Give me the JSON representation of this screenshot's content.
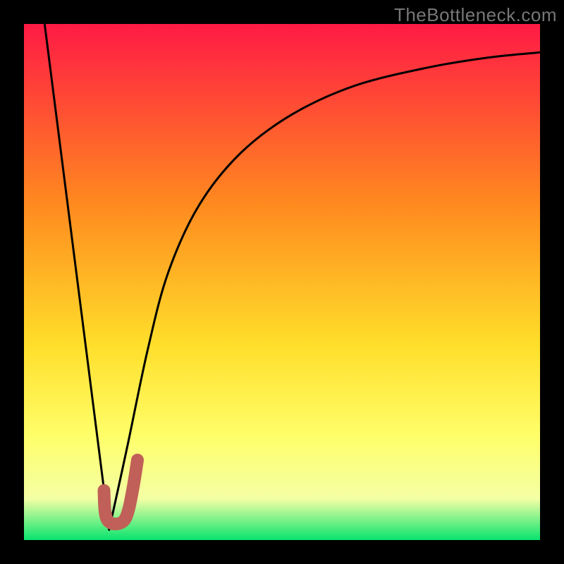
{
  "watermark": "TheBottleneck.com",
  "colors": {
    "frame": "#000000",
    "gradient_top": "#ff1a45",
    "gradient_mid1": "#ff8a1f",
    "gradient_mid2": "#ffde2a",
    "gradient_mid3": "#ffff6a",
    "gradient_mid4": "#f4ffa5",
    "gradient_bottom": "#08e46e",
    "curve": "#000000",
    "marker": "#c06058"
  },
  "chart_data": {
    "type": "line",
    "title": "",
    "xlabel": "",
    "ylabel": "",
    "xlim": [
      0,
      100
    ],
    "ylim": [
      0,
      100
    ],
    "series": [
      {
        "name": "left-branch",
        "x": [
          4,
          16.5
        ],
        "y": [
          100,
          2
        ]
      },
      {
        "name": "right-branch",
        "x": [
          16.5,
          20,
          24,
          28,
          34,
          42,
          52,
          64,
          78,
          90,
          100
        ],
        "y": [
          2,
          18,
          37,
          52,
          65,
          75,
          82.5,
          88,
          91.5,
          93.5,
          94.5
        ]
      }
    ],
    "marker": {
      "name": "J-marker",
      "path_xy": [
        [
          15.5,
          9.6
        ],
        [
          15.7,
          5.6
        ],
        [
          16.3,
          3.7
        ],
        [
          17.8,
          3.1
        ],
        [
          19.4,
          3.8
        ],
        [
          20.3,
          6.0
        ],
        [
          21.2,
          10.5
        ],
        [
          22.0,
          15.5
        ]
      ],
      "stroke_width_px": 18
    },
    "axes_visible": false,
    "legend_visible": false,
    "grid": false
  }
}
